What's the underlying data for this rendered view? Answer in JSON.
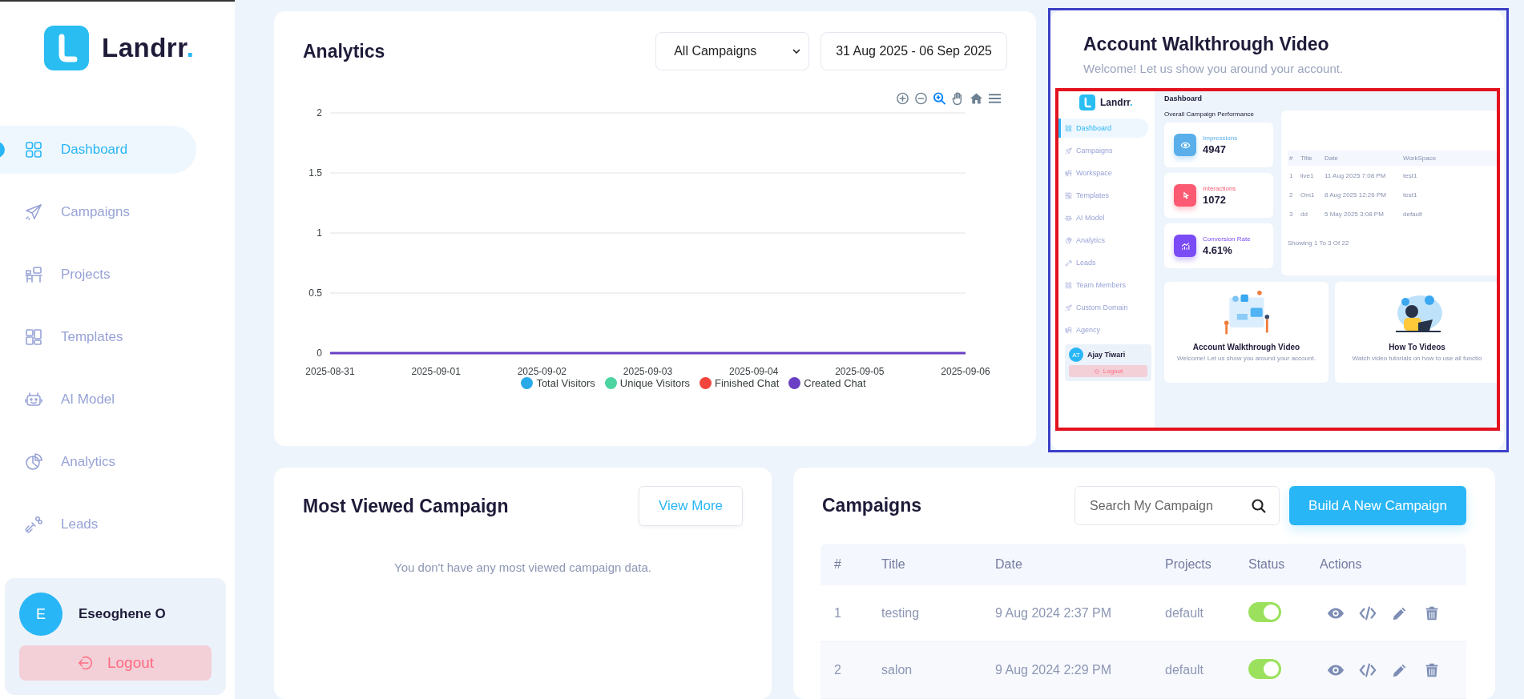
{
  "sidebar": {
    "logo": {
      "name": "Landrr",
      "dot": "."
    },
    "nav": [
      {
        "label": "Dashboard",
        "selected": true
      },
      {
        "label": "Campaigns",
        "selected": false
      },
      {
        "label": "Projects",
        "selected": false
      },
      {
        "label": "Templates",
        "selected": false
      },
      {
        "label": "AI Model",
        "selected": false
      },
      {
        "label": "Analytics",
        "selected": false
      },
      {
        "label": "Leads",
        "selected": false
      }
    ],
    "user": {
      "initial": "E",
      "name": "Eseoghene O"
    },
    "logout": "Logout"
  },
  "analytics": {
    "title": "Analytics",
    "campaign_select": "All Campaigns",
    "date_range": "31 Aug 2025 - 06 Sep 2025",
    "chart_data": {
      "type": "line",
      "categories": [
        "2025-08-31",
        "2025-09-01",
        "2025-09-02",
        "2025-09-03",
        "2025-09-04",
        "2025-09-05",
        "2025-09-06"
      ],
      "ylim": [
        0,
        2
      ],
      "grid": true,
      "yticks": [
        0,
        0.5,
        1,
        1.5,
        2
      ],
      "series": [
        {
          "name": "Total Visitors",
          "color": "#2aaae8",
          "values": [
            null,
            null,
            null,
            null,
            null,
            null,
            null
          ]
        },
        {
          "name": "Unique Visitors",
          "color": "#4bd4a0",
          "values": [
            null,
            null,
            null,
            null,
            null,
            null,
            null
          ]
        },
        {
          "name": "Finished Chat",
          "color": "#f2453d",
          "values": [
            null,
            null,
            null,
            null,
            null,
            null,
            null
          ]
        },
        {
          "name": "Created Chat",
          "color": "#6a3fc4",
          "values": [
            0,
            0,
            0,
            0,
            0,
            0,
            0
          ]
        }
      ]
    }
  },
  "walkthrough": {
    "title": "Account Walkthrough Video",
    "subtitle": "Welcome! Let us show you around your account.",
    "preview": {
      "logo": {
        "name": "Landrr",
        "dot": "."
      },
      "nav": [
        {
          "label": "Dashboard",
          "selected": true
        },
        {
          "label": "Campaigns",
          "selected": false
        },
        {
          "label": "Workspace",
          "selected": false
        },
        {
          "label": "Templates",
          "selected": false
        },
        {
          "label": "AI Model",
          "selected": false
        },
        {
          "label": "Analytics",
          "selected": false
        },
        {
          "label": "Leads",
          "selected": false
        },
        {
          "label": "Team Members",
          "selected": false
        },
        {
          "label": "Custom Domain",
          "selected": false
        },
        {
          "label": "Agency",
          "selected": false
        }
      ],
      "user": {
        "initial": "AT",
        "name": "Ajay Tiwari"
      },
      "logout": "Logout",
      "heading": "Dashboard",
      "section_title": "Overall Campaign Performance",
      "stats": [
        {
          "label": "Impressions",
          "value": "4947",
          "color": "#5aaeea"
        },
        {
          "label": "Interactions",
          "value": "1072",
          "color": "#fb5a72"
        },
        {
          "label": "Conversion Rate",
          "value": "4.61%",
          "color": "#7b4cf6"
        }
      ],
      "table": {
        "columns": [
          "#",
          "Title",
          "Date",
          "WorkSpace"
        ],
        "rows": [
          {
            "cells": [
              "1",
              "live1",
              "11 Aug 2025 7:08 PM",
              "test1"
            ]
          },
          {
            "cells": [
              "2",
              "Om1",
              "8 Aug 2025 12:26 PM",
              "test1"
            ]
          },
          {
            "cells": [
              "3",
              "dd",
              "5 May 2025 3:08 PM",
              "default"
            ]
          }
        ],
        "footer": "Showing 1 To 3 Of 22"
      },
      "cards": [
        {
          "title": "Account Walkthrough Video",
          "subtitle": "Welcome! Let us show you around your account."
        },
        {
          "title": "How To Videos",
          "subtitle": "Watch video tutorials on how to use all functio"
        }
      ]
    }
  },
  "most_viewed": {
    "title": "Most Viewed Campaign",
    "view_more": "View More",
    "empty": "You don't have any most viewed campaign data."
  },
  "campaigns": {
    "title": "Campaigns",
    "search": {
      "placeholder": "Search My Campaign"
    },
    "build": "Build A New Campaign",
    "columns": [
      "#",
      "Title",
      "Date",
      "Projects",
      "Status",
      "Actions"
    ],
    "rows": [
      {
        "num": "1",
        "title": "testing",
        "date": "9 Aug 2024 2:37 PM",
        "project": "default",
        "on": true
      },
      {
        "num": "2",
        "title": "salon",
        "date": "9 Aug 2024 2:29 PM",
        "project": "default",
        "on": true
      }
    ]
  }
}
